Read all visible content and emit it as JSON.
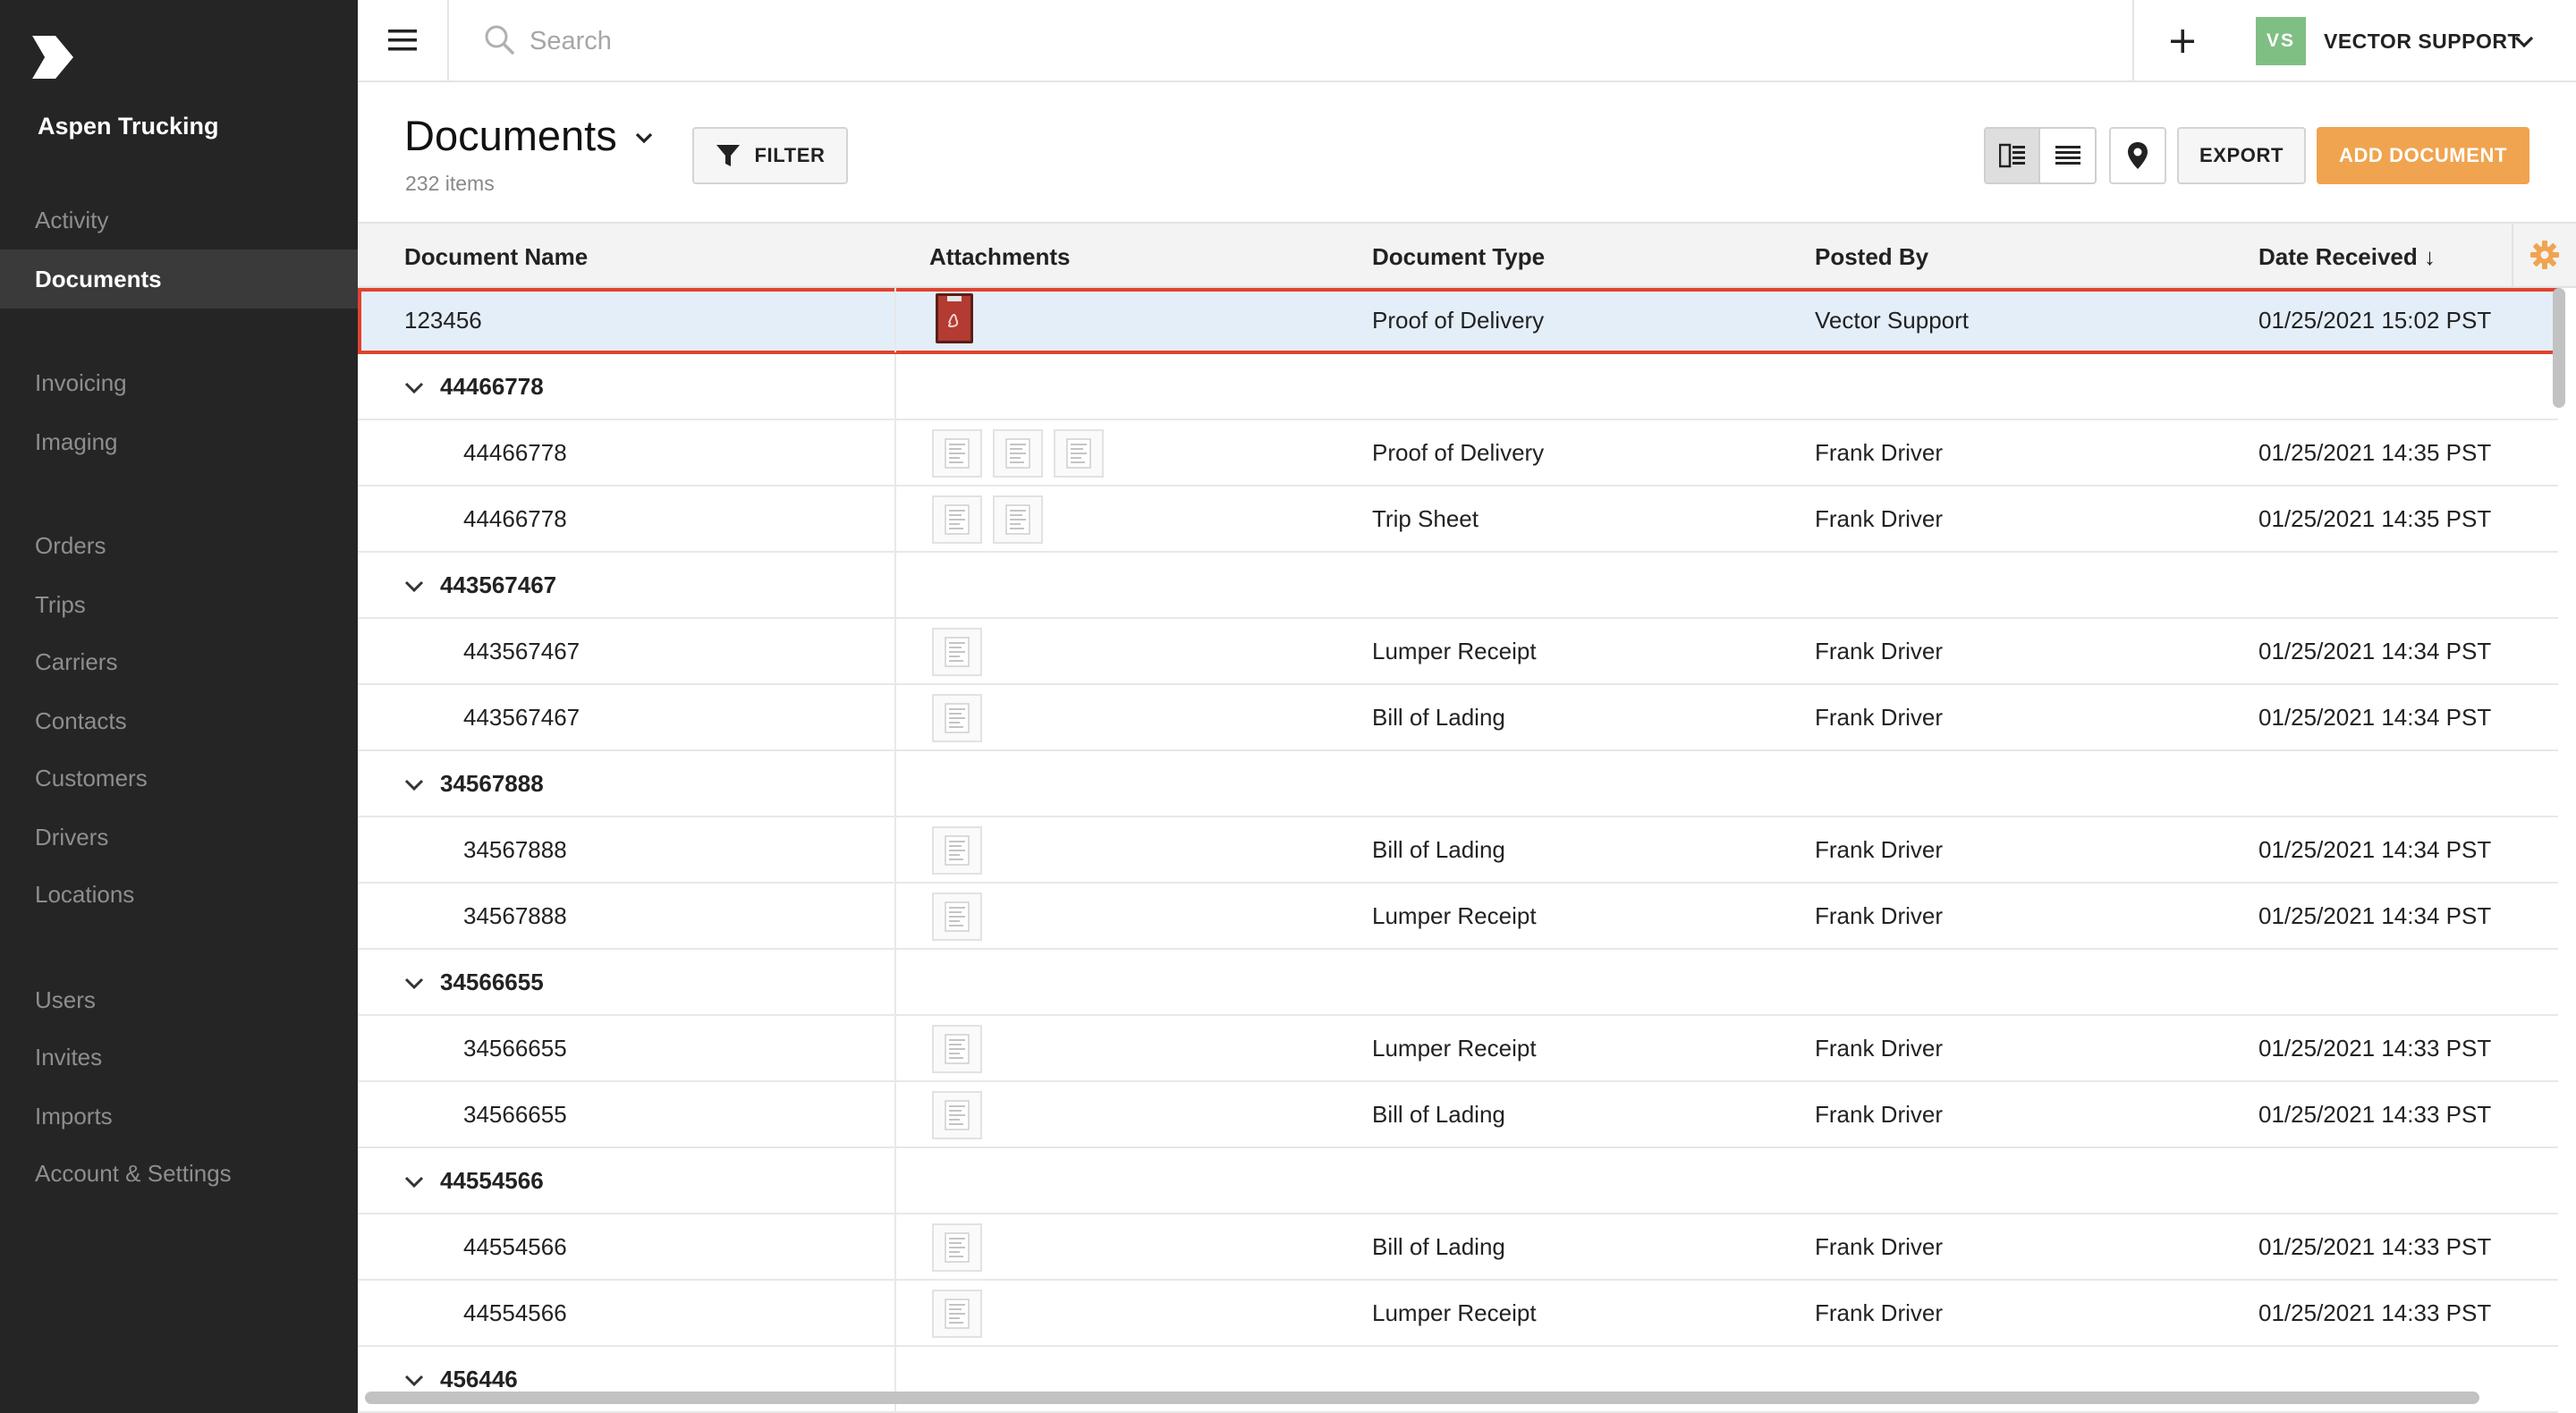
{
  "sidebar": {
    "org_name": "Aspen Trucking",
    "items": [
      {
        "label": "Activity"
      },
      {
        "label": "Documents"
      },
      {
        "label": "Invoicing"
      },
      {
        "label": "Imaging"
      },
      {
        "label": "Orders"
      },
      {
        "label": "Trips"
      },
      {
        "label": "Carriers"
      },
      {
        "label": "Contacts"
      },
      {
        "label": "Customers"
      },
      {
        "label": "Drivers"
      },
      {
        "label": "Locations"
      },
      {
        "label": "Users"
      },
      {
        "label": "Invites"
      },
      {
        "label": "Imports"
      },
      {
        "label": "Account & Settings"
      }
    ],
    "active_item": "Documents"
  },
  "topbar": {
    "search_placeholder": "Search",
    "user_initials": "VS",
    "user_name": "VECTOR SUPPORT",
    "avatar_color": "#7fbf84"
  },
  "page": {
    "title": "Documents",
    "count": "232 items",
    "filter_label": "FILTER",
    "export_label": "EXPORT",
    "add_label": "ADD DOCUMENT",
    "accent_color": "#f0a450"
  },
  "table": {
    "columns": [
      "Document Name",
      "Attachments",
      "Document Type",
      "Posted By",
      "Date Received ↓"
    ],
    "rows": [
      {
        "kind": "doc",
        "selected": true,
        "name": "123456",
        "attachments": "pdf",
        "type": "Proof of Delivery",
        "posted_by": "Vector Support",
        "date": "01/25/2021 15:02 PST"
      },
      {
        "kind": "group",
        "name": "44466778"
      },
      {
        "kind": "child",
        "name": "44466778",
        "thumbs": 3,
        "type": "Proof of Delivery",
        "posted_by": "Frank Driver",
        "date": "01/25/2021 14:35 PST"
      },
      {
        "kind": "child",
        "name": "44466778",
        "thumbs": 2,
        "type": "Trip Sheet",
        "posted_by": "Frank Driver",
        "date": "01/25/2021 14:35 PST"
      },
      {
        "kind": "group",
        "name": "443567467"
      },
      {
        "kind": "child",
        "name": "443567467",
        "thumbs": 1,
        "type": "Lumper Receipt",
        "posted_by": "Frank Driver",
        "date": "01/25/2021 14:34 PST"
      },
      {
        "kind": "child",
        "name": "443567467",
        "thumbs": 1,
        "type": "Bill of Lading",
        "posted_by": "Frank Driver",
        "date": "01/25/2021 14:34 PST"
      },
      {
        "kind": "group",
        "name": "34567888"
      },
      {
        "kind": "child",
        "name": "34567888",
        "thumbs": 1,
        "type": "Bill of Lading",
        "posted_by": "Frank Driver",
        "date": "01/25/2021 14:34 PST"
      },
      {
        "kind": "child",
        "name": "34567888",
        "thumbs": 1,
        "type": "Lumper Receipt",
        "posted_by": "Frank Driver",
        "date": "01/25/2021 14:34 PST"
      },
      {
        "kind": "group",
        "name": "34566655"
      },
      {
        "kind": "child",
        "name": "34566655",
        "thumbs": 1,
        "type": "Lumper Receipt",
        "posted_by": "Frank Driver",
        "date": "01/25/2021 14:33 PST"
      },
      {
        "kind": "child",
        "name": "34566655",
        "thumbs": 1,
        "type": "Bill of Lading",
        "posted_by": "Frank Driver",
        "date": "01/25/2021 14:33 PST"
      },
      {
        "kind": "group",
        "name": "44554566"
      },
      {
        "kind": "child",
        "name": "44554566",
        "thumbs": 1,
        "type": "Bill of Lading",
        "posted_by": "Frank Driver",
        "date": "01/25/2021 14:33 PST"
      },
      {
        "kind": "child",
        "name": "44554566",
        "thumbs": 1,
        "type": "Lumper Receipt",
        "posted_by": "Frank Driver",
        "date": "01/25/2021 14:33 PST"
      },
      {
        "kind": "group",
        "name": "456446"
      }
    ]
  }
}
